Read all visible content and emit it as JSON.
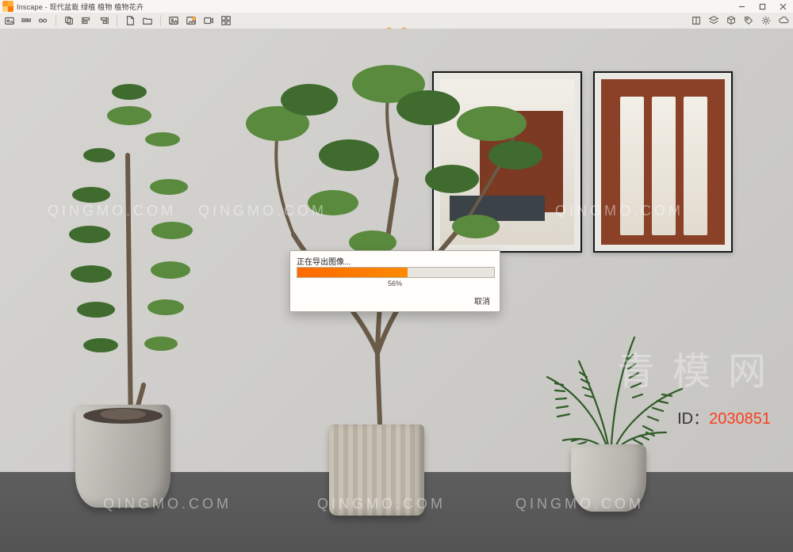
{
  "app": {
    "name": "Inscape",
    "document_title": "现代盆栽 绿植 植物 植物花卉",
    "title_joined": "Inscape - 现代盆栽 绿植 植物 植物花卉"
  },
  "window_controls": {
    "minimize": "minimize",
    "maximize": "maximize",
    "close": "close"
  },
  "toolbar_left": {
    "library": "library-icon",
    "bim_label": "BIM",
    "link": "link-icon",
    "copy": "copy-icon",
    "align_left": "align-left-icon",
    "align_right": "align-right-icon",
    "page": "page-icon",
    "folder": "folder-icon",
    "image_a": "image-export-a-icon",
    "image_b": "image-export-b-icon",
    "video": "video-export-icon",
    "grid": "grid-icon"
  },
  "toolbar_right": {
    "book": "book-icon",
    "layers": "layers-icon",
    "cube": "cube-icon",
    "tag": "tag-icon",
    "gear": "gear-icon",
    "cloud": "cloud-icon"
  },
  "dialog": {
    "title": "正在导出图像...",
    "percent_value": 56,
    "percent_label": "56%",
    "cancel": "取消"
  },
  "watermarks": {
    "text": "QINGMO.COM",
    "brand_chars": [
      "青",
      "模",
      "网"
    ],
    "id_prefix": "ID：",
    "id_value": "2030851"
  },
  "accent_color": "#ff8a00"
}
